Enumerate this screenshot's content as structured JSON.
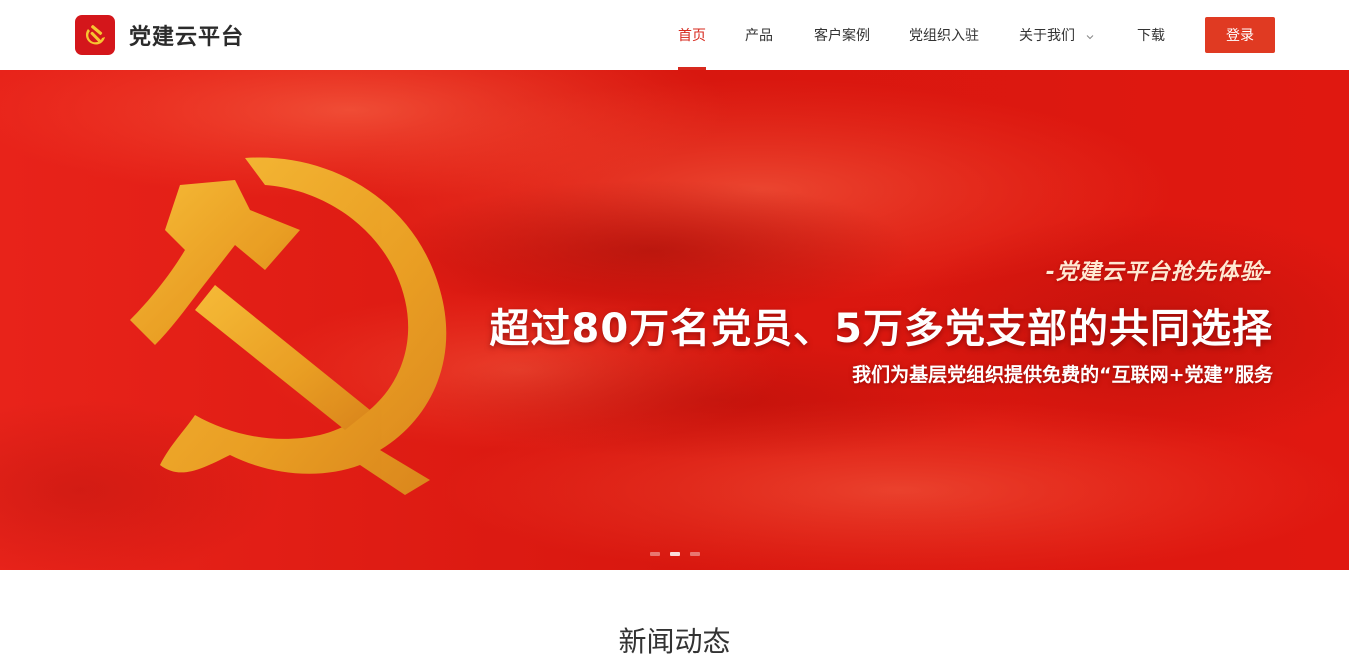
{
  "brand": {
    "title": "党建云平台",
    "logo_icon": "hammer-sickle-icon",
    "logo_color": "#d4161b"
  },
  "nav": {
    "items": [
      {
        "label": "首页",
        "active": true
      },
      {
        "label": "产品"
      },
      {
        "label": "客户案例"
      },
      {
        "label": "党组织入驻"
      },
      {
        "label": "关于我们",
        "has_dropdown": true
      },
      {
        "label": "下载"
      }
    ],
    "login_label": "登录",
    "accent_color": "#d7291e",
    "button_color": "#e03a22"
  },
  "banner": {
    "tagline": "-党建云平台抢先体验-",
    "headline": "超过80万名党员、5万多党支部的共同选择",
    "subline": "我们为基层党组织提供免费的“互联网+党建”服务",
    "background_color": "#e31d16",
    "emblem_color": "#f2b51e",
    "slide_count": 3,
    "active_slide": 1
  },
  "news": {
    "title": "新闻动态"
  }
}
